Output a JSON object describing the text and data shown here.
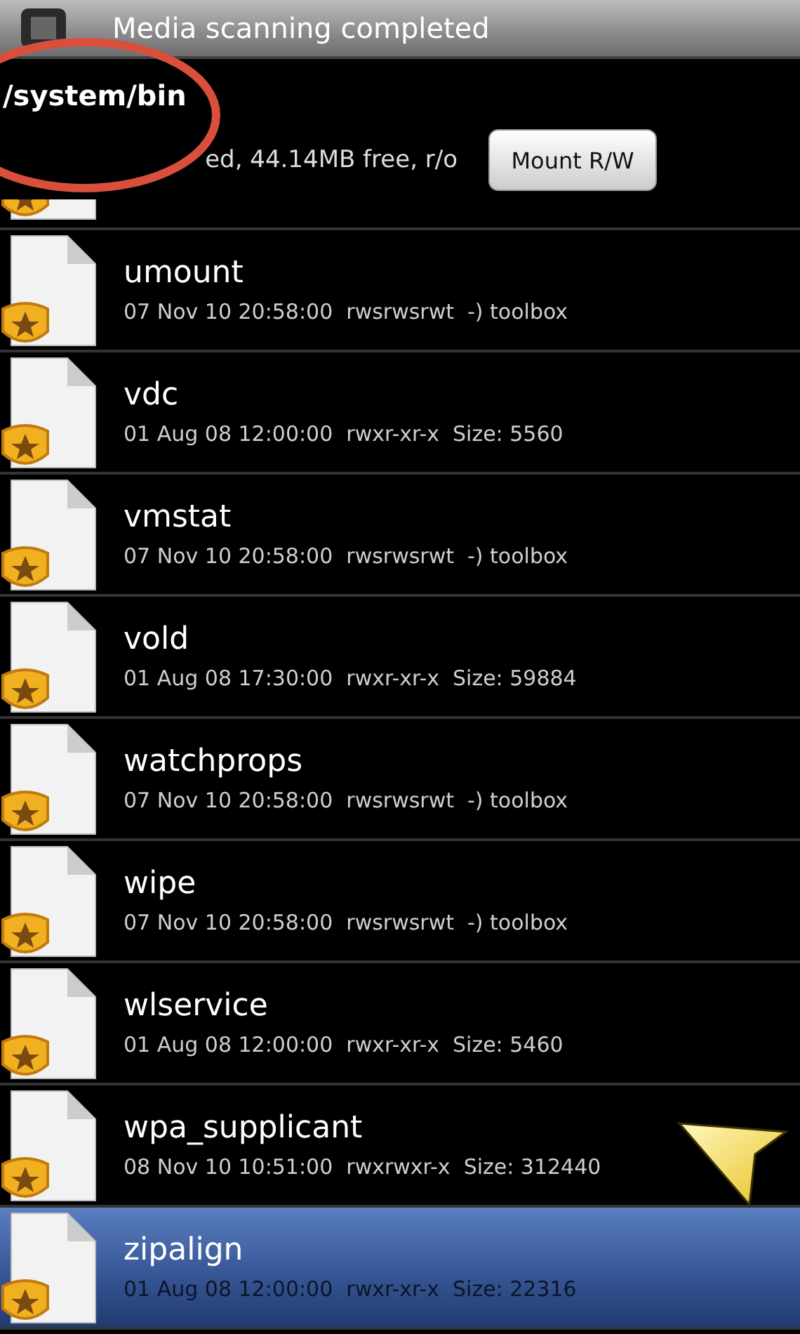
{
  "status_bar": {
    "notification": "Media scanning completed"
  },
  "header": {
    "path": "/system/bin",
    "storage": "ed, 44.14MB free, r/o",
    "mount_button": "Mount R/W"
  },
  "files": [
    {
      "name": "umount",
      "detail": "07 Nov 10 20:58:00  rwsrwsrwt  -) toolbox",
      "selected": false
    },
    {
      "name": "vdc",
      "detail": "01 Aug 08 12:00:00  rwxr-xr-x  Size: 5560",
      "selected": false
    },
    {
      "name": "vmstat",
      "detail": "07 Nov 10 20:58:00  rwsrwsrwt  -) toolbox",
      "selected": false
    },
    {
      "name": "vold",
      "detail": "01 Aug 08 17:30:00  rwxr-xr-x  Size: 59884",
      "selected": false
    },
    {
      "name": "watchprops",
      "detail": "07 Nov 10 20:58:00  rwsrwsrwt  -) toolbox",
      "selected": false
    },
    {
      "name": "wipe",
      "detail": "07 Nov 10 20:58:00  rwsrwsrwt  -) toolbox",
      "selected": false
    },
    {
      "name": "wlservice",
      "detail": "01 Aug 08 12:00:00  rwxr-xr-x  Size: 5460",
      "selected": false
    },
    {
      "name": "wpa_supplicant",
      "detail": "08 Nov 10 10:51:00  rwxrwxr-x  Size: 312440",
      "selected": false
    },
    {
      "name": "zipalign",
      "detail": "01 Aug 08 12:00:00  rwxr-xr-x  Size: 22316",
      "selected": true
    }
  ]
}
